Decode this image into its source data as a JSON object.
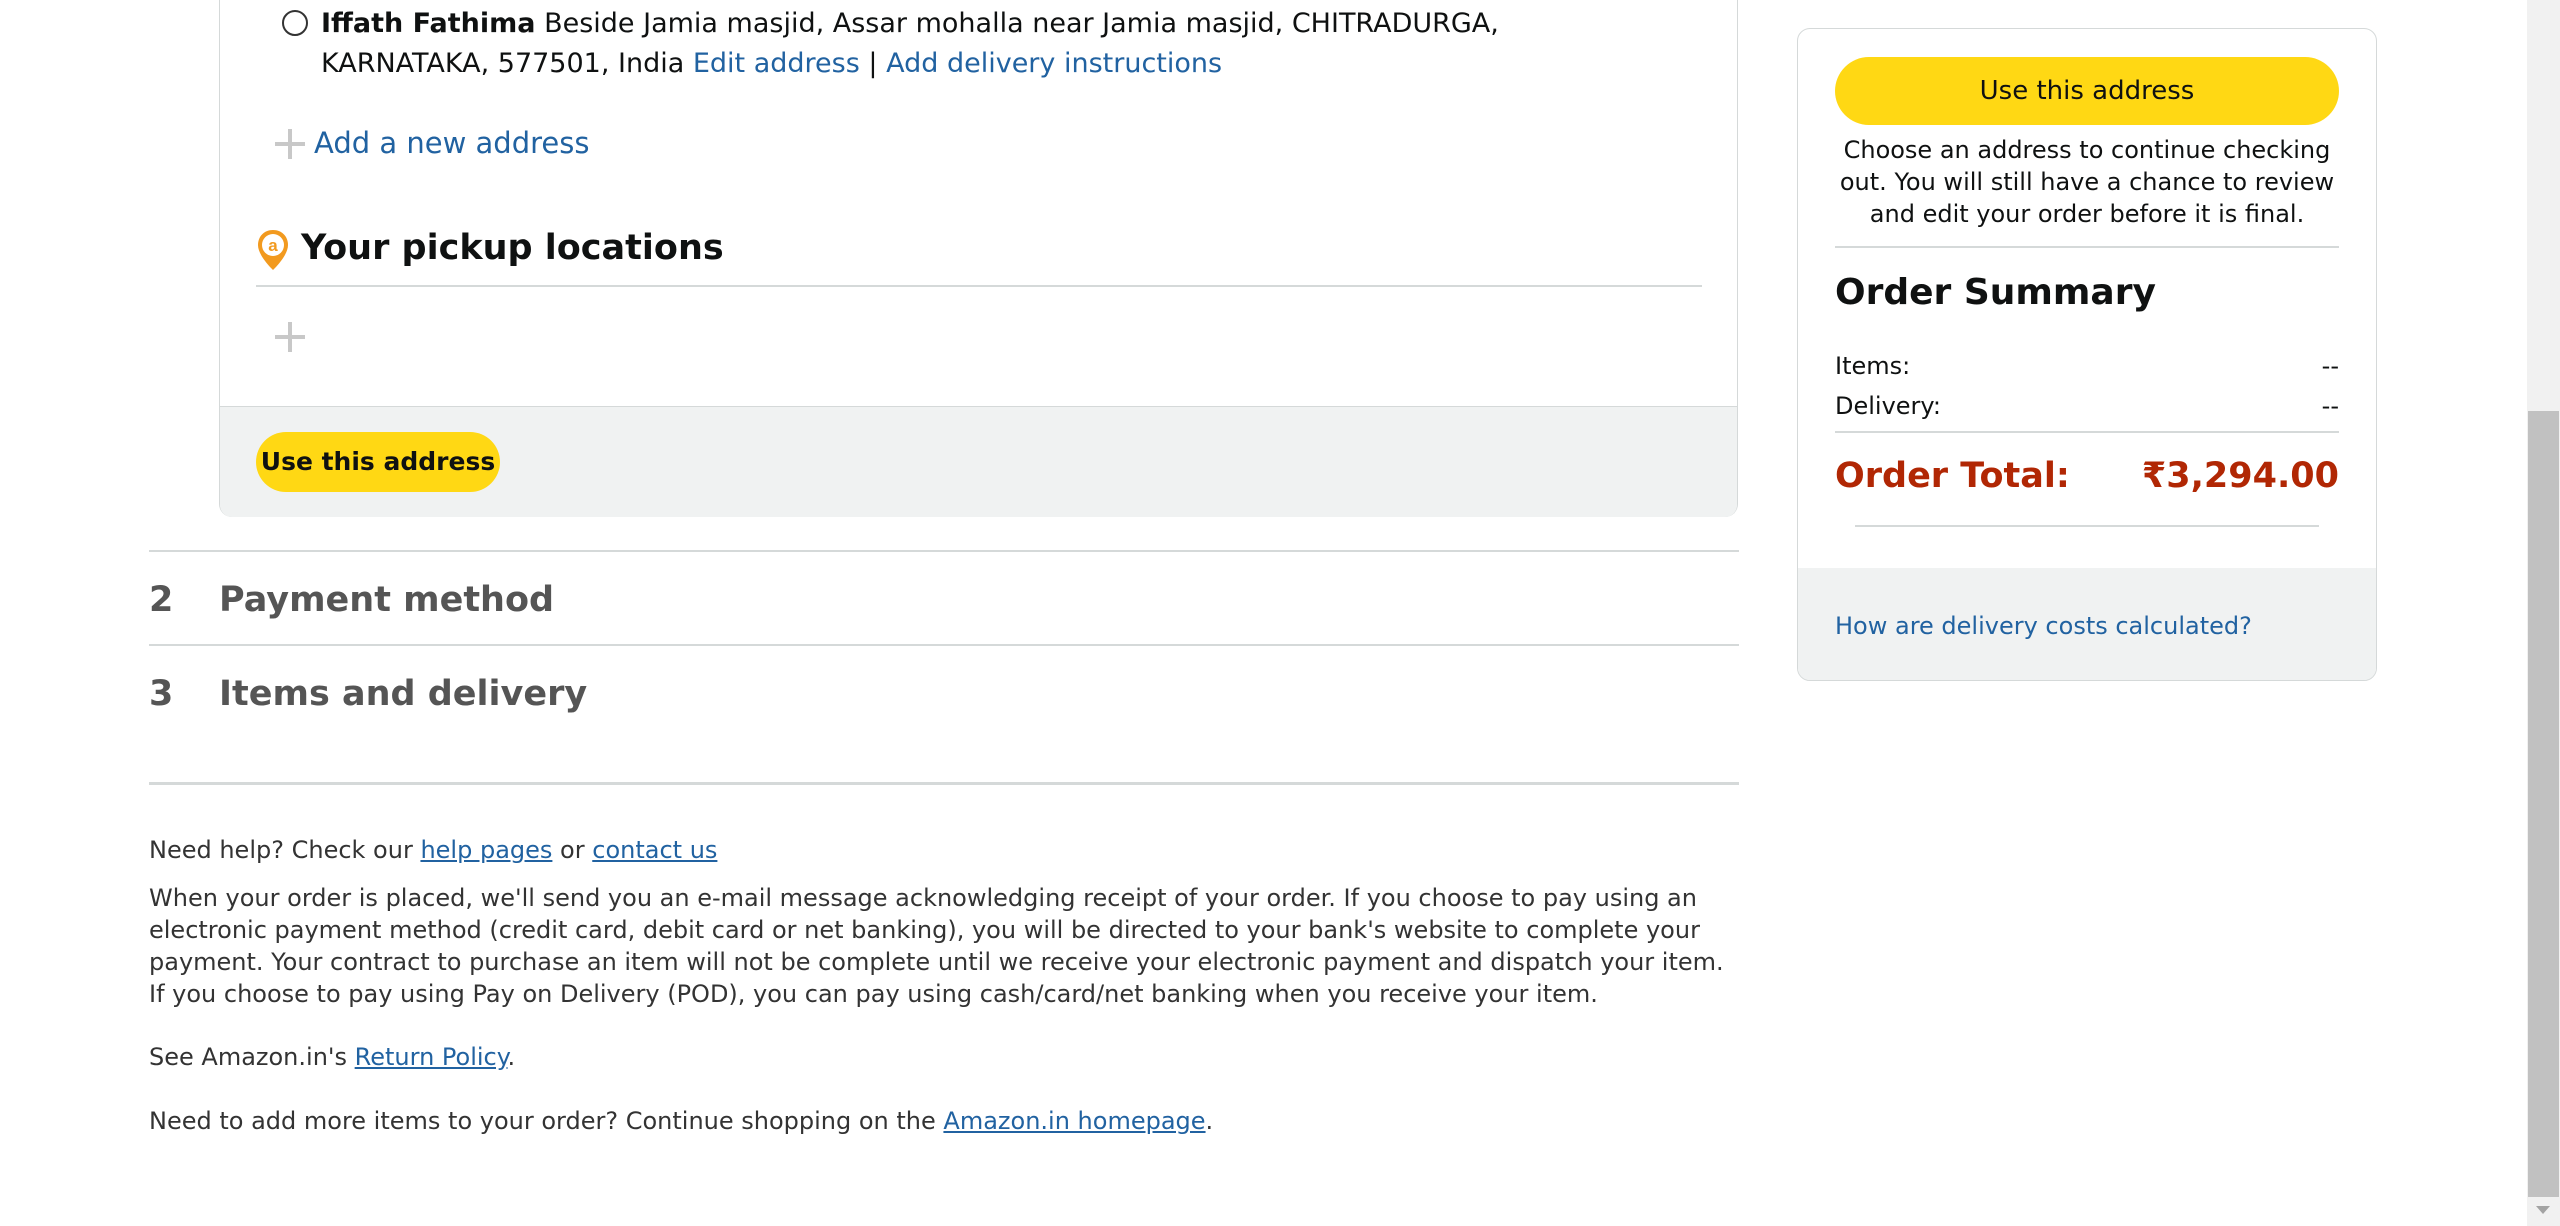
{
  "address": {
    "name": "Iffath Fathima",
    "line": "Beside Jamia masjid, Assar mohalla near Jamia masjid, CHITRADURGA, KARNATAKA, 577501, India",
    "edit_link": "Edit address",
    "separator": "|",
    "instructions_link": "Add delivery instructions"
  },
  "add_new_address": "Add a new address",
  "pickup": {
    "heading": "Your pickup locations"
  },
  "use_address_bottom": "Use this address",
  "steps": [
    {
      "number": "2",
      "title": "Payment method"
    },
    {
      "number": "3",
      "title": "Items and delivery"
    }
  ],
  "footer": {
    "help_prefix": "Need help? Check our",
    "help_link": "help pages",
    "help_or": "or",
    "contact_link": "contact us",
    "disclaimer": "When your order is placed, we'll send you an e-mail message acknowledging receipt of your order. If you choose to pay using an electronic payment method (credit card, debit card or net banking), you will be directed to your bank's website to complete your payment. Your contract to purchase an item will not be complete until we receive your electronic payment and dispatch your item. If you choose to pay using Pay on Delivery (POD), you can pay using cash/card/net banking when you receive your item.",
    "return_prefix": "See Amazon.in's",
    "return_link": "Return Policy",
    "return_suffix": ".",
    "shop_prefix": "Need to add more items to your order? Continue shopping on the",
    "shop_link": "Amazon.in homepage",
    "shop_suffix": "."
  },
  "sidebar": {
    "use_address_top": "Use this address",
    "choose_note": "Choose an address to continue checking out. You will still have a chance to review and edit your order before it is final.",
    "summary_title": "Order Summary",
    "items_label": "Items:",
    "items_value": "--",
    "delivery_label": "Delivery:",
    "delivery_value": "--",
    "total_label": "Order Total:",
    "total_value": "₹3,294.00",
    "delivery_costs_link": "How are delivery costs calculated?"
  },
  "colors": {
    "button_yellow": "#ffd814",
    "link_blue": "#2162a1",
    "total_red": "#b12704",
    "pin_orange": "#f29a1f"
  }
}
